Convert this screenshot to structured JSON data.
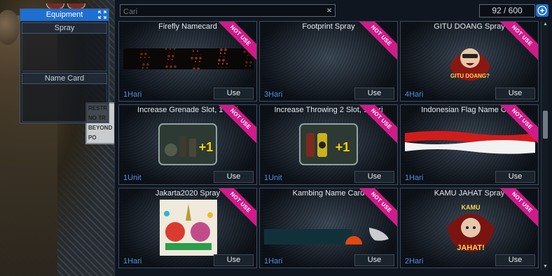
{
  "equipment": {
    "title": "Equipment",
    "slots": [
      {
        "label": "Spray"
      },
      {
        "label": "Name Card"
      }
    ]
  },
  "backdrop": {
    "sign_lines": [
      "RESTR",
      "NO TR",
      "BEYOND",
      "PO"
    ]
  },
  "search": {
    "placeholder": "Cari",
    "value": "Cari"
  },
  "inventory": {
    "count": "92 / 600"
  },
  "ribbon_text": "NOT USE",
  "use_label": "Use",
  "items": [
    {
      "title": "Firefly Namecard",
      "duration": "1Hari",
      "art": "firefly-namecard"
    },
    {
      "title": "Footprint Spray",
      "duration": "3Hari",
      "art": "footprint-spray"
    },
    {
      "title": "GITU DOANG Spray",
      "duration": "4Hari",
      "art": "gitu-doang-spray",
      "art_text": "GITU DOANG?"
    },
    {
      "title": "Increase Grenade Slot, 1 hari",
      "duration": "1Unit",
      "art": "grenade-slot",
      "art_text": "+1"
    },
    {
      "title": "Increase Throwing 2 Slot, 1 hari",
      "duration": "1Unit",
      "art": "throwing-slot",
      "art_text": "+1"
    },
    {
      "title": "Indonesian Flag Name Card",
      "duration": "1Hari",
      "art": "indonesian-flag"
    },
    {
      "title": "Jakarta2020 Spray",
      "duration": "1Hari",
      "art": "jakarta-spray"
    },
    {
      "title": "Kambing Name Card",
      "duration": "1Hari",
      "art": "kambing-namecard"
    },
    {
      "title": "KAMU JAHAT Spray",
      "duration": "2Hari",
      "art": "kamu-jahat-spray",
      "art_text_top": "KAMU",
      "art_text": "JAHAT!"
    }
  ],
  "colors": {
    "accent_blue": "#1d6fd1",
    "ribbon_magenta": "#d21a8a",
    "duration_blue": "#4f8fdc"
  }
}
